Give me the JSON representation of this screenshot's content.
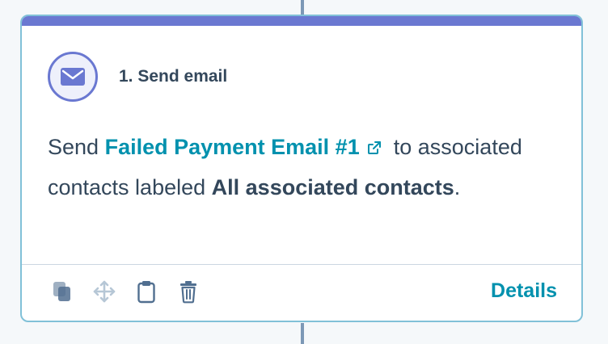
{
  "action": {
    "step_title": "1. Send email",
    "icon": "envelope-icon",
    "accent_color": "#6a78d1"
  },
  "body": {
    "prefix": "Send",
    "email_name": "Failed Payment Email #1",
    "after_link": "to",
    "middle_text": "associated contacts labeled",
    "label_name": "All associated contacts",
    "suffix": "."
  },
  "footer": {
    "icons": [
      "clone-icon",
      "move-icon",
      "clipboard-icon",
      "trash-icon"
    ],
    "details_label": "Details"
  },
  "colors": {
    "link": "#0091ae",
    "text": "#33475b",
    "card_border": "#81c1d8",
    "top_bar": "#6a78d1"
  }
}
